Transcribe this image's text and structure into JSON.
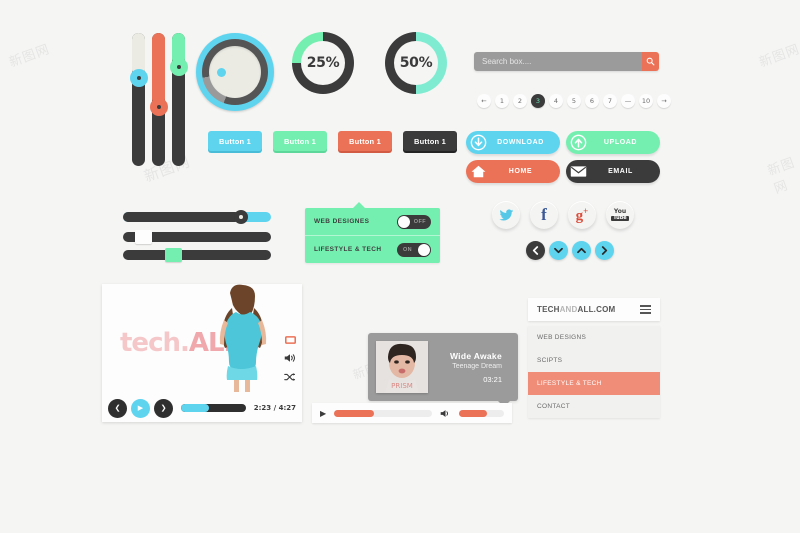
{
  "page": {
    "background": "#f5f5f4",
    "watermark": "新图网"
  },
  "palette": {
    "cyan": "#5fd4ef",
    "mint": "#75efb0",
    "coral": "#ec7257",
    "dark": "#3b3b3b",
    "gray": "#9b9b9b",
    "cream": "#ebebe4"
  },
  "vertical_sliders": [
    {
      "name": "slider-cream",
      "fill_color": "#ebebe4",
      "knob_color": "#5fd4ef",
      "value": 30
    },
    {
      "name": "slider-coral",
      "fill_color": "#ec7257",
      "knob_color": "#ec7257",
      "value": 52
    },
    {
      "name": "slider-mint",
      "fill_color": "#75efb0",
      "knob_color": "#75efb0",
      "value": 22
    }
  ],
  "dial": {
    "label": "volume-dial",
    "ring_color": "#5fd4ef",
    "indicator_color": "#5fd4ef"
  },
  "donuts": [
    {
      "label": "25%",
      "value": 25,
      "track_color": "#3b3b3b",
      "fill_color": "#75efb0"
    },
    {
      "label": "50%",
      "value": 50,
      "track_color": "#3b3b3b",
      "fill_color": "#7fecd1"
    }
  ],
  "search": {
    "placeholder": "Search box....",
    "value": "",
    "button_color": "#ec7257",
    "field_color": "#9b9b9b"
  },
  "pagination": {
    "prev": "←",
    "next": "→",
    "items": [
      "1",
      "2",
      "3",
      "4",
      "5",
      "6",
      "7",
      "—",
      "10"
    ],
    "active": "3",
    "active_text_color": "#6fe0b6"
  },
  "buttons": [
    {
      "label": "Button 1",
      "color": "#5fd4ef",
      "shadow": "#4cbcd6"
    },
    {
      "label": "Button 1",
      "color": "#75efb0",
      "shadow": "#5fd89a"
    },
    {
      "label": "Button 1",
      "color": "#ec7257",
      "shadow": "#d45f46"
    },
    {
      "label": "Button 1",
      "color": "#3b3b3b",
      "shadow": "#262626"
    }
  ],
  "action_buttons": [
    {
      "label": "DOWNLOAD",
      "icon": "download-arrow-icon",
      "color": "#5fd4ef"
    },
    {
      "label": "UPLOAD",
      "icon": "upload-arrow-icon",
      "color": "#75efb0"
    },
    {
      "label": "HOME",
      "icon": "house-icon",
      "color": "#ec7257"
    },
    {
      "label": "EMAIL",
      "icon": "envelope-icon",
      "color": "#3b3b3b"
    }
  ],
  "horizontal_sliders": [
    {
      "name": "slider-cyan",
      "value": 78,
      "fill_color": "#3b3b3b",
      "rest_color": "#5fd4ef",
      "knob": "circle"
    },
    {
      "name": "slider-white",
      "value": 8,
      "fill_color": "#3b3b3b",
      "rest_color": "#3b3b3b",
      "knob": "square",
      "knob_color": "#fdfdfd"
    },
    {
      "name": "slider-mint",
      "value": 33,
      "fill_color": "#3b3b3b",
      "rest_color": "#3b3b3b",
      "knob": "square",
      "knob_color": "#75efb0"
    }
  ],
  "toggle_panel": {
    "background": "#75efb0",
    "rows": [
      {
        "label": "WEB DESIGNES",
        "state": "OFF",
        "on": false
      },
      {
        "label": "LIFESTYLE & TECH",
        "state": "ON",
        "on": true
      }
    ]
  },
  "social": [
    {
      "name": "twitter-icon",
      "glyph": "t",
      "color": "#55c8e8"
    },
    {
      "name": "facebook-icon",
      "glyph": "f",
      "color": "#3b5998"
    },
    {
      "name": "googleplus-icon",
      "glyph": "g+",
      "color": "#dd4b39"
    },
    {
      "name": "youtube-icon",
      "glyph": "You Tube",
      "color": "#3b3b3b"
    }
  ],
  "arrow_nav": [
    {
      "name": "arrow-left-button",
      "glyph": "❮",
      "color": "#3b3b3b"
    },
    {
      "name": "arrow-down-button",
      "glyph": "❯",
      "color": "#5fd4ef"
    },
    {
      "name": "arrow-up-button",
      "glyph": "❯",
      "color": "#5fd4ef"
    },
    {
      "name": "arrow-right-button",
      "glyph": "❯",
      "color": "#5fd4ef"
    }
  ],
  "video_player": {
    "logo_prefix": "tech.",
    "logo_suffix": "ALL",
    "time": "2:23 / 4:27",
    "progress": 44,
    "progress_color": "#5fd4ef",
    "prev_label": "❮",
    "play_label": "▶",
    "next_label": "❯",
    "side_icons": [
      "fullscreen-icon",
      "volume-icon",
      "shuffle-icon"
    ]
  },
  "audio_player": {
    "title": "Wide Awake",
    "artist": "Teenage Dream",
    "duration": "03:21",
    "play_label": "▶",
    "progress": 41,
    "volume": 62,
    "progress_color": "#ec7257"
  },
  "menu": {
    "brand_start": "TECH",
    "brand_mid": "AND",
    "brand_end": "ALL.COM",
    "hamburger": "menu-icon",
    "items": [
      {
        "label": "WEB DESIGNS",
        "active": false
      },
      {
        "label": "SCIPTS",
        "active": false
      },
      {
        "label": "LIFESTYLE & TECH",
        "active": true
      },
      {
        "label": "CONTACT",
        "active": false
      }
    ]
  }
}
